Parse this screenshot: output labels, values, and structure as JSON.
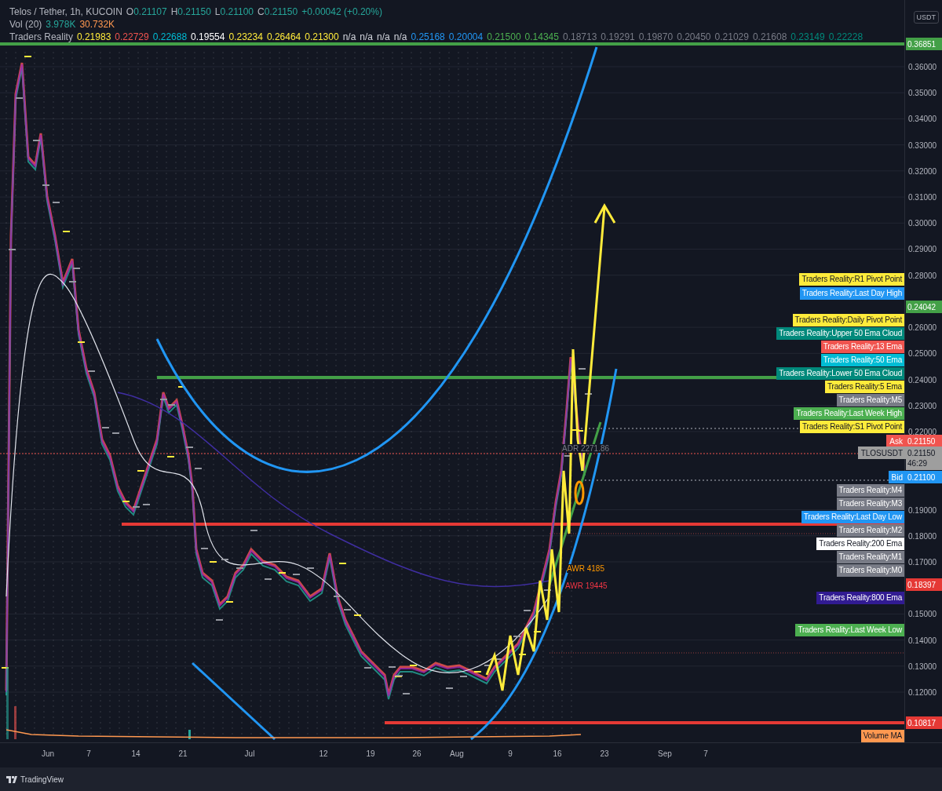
{
  "legend": {
    "symbol": "Telos / Tether, 1h, KUCOIN",
    "ohlc": [
      {
        "label": "O",
        "value": "0.21107"
      },
      {
        "label": "H",
        "value": "0.21150"
      },
      {
        "label": "L",
        "value": "0.21100"
      },
      {
        "label": "C",
        "value": "0.21150"
      }
    ],
    "change": "+0.00042 (+0.20%)",
    "volume": {
      "label": "Vol (20)",
      "values": [
        {
          "value": "3.978K",
          "color": "#26a69a"
        },
        {
          "value": "30.732K",
          "color": "#ff9850"
        }
      ]
    },
    "indicator": {
      "label": "Traders Reality",
      "values": [
        {
          "value": "0.21983",
          "color": "#ffeb3b"
        },
        {
          "value": "0.22729",
          "color": "#f0544f"
        },
        {
          "value": "0.22688",
          "color": "#00bcd4"
        },
        {
          "value": "0.19554",
          "color": "#ffffff"
        },
        {
          "value": "0.23234",
          "color": "#ffeb3b"
        },
        {
          "value": "0.26464",
          "color": "#ffeb3b"
        },
        {
          "value": "0.21300",
          "color": "#ffeb3b"
        },
        {
          "value": "n/a",
          "color": "#d1d4dc"
        },
        {
          "value": "n/a",
          "color": "#d1d4dc"
        },
        {
          "value": "n/a",
          "color": "#d1d4dc"
        },
        {
          "value": "n/a",
          "color": "#d1d4dc"
        },
        {
          "value": "0.25168",
          "color": "#2196f3"
        },
        {
          "value": "0.20004",
          "color": "#2196f3"
        },
        {
          "value": "0.21500",
          "color": "#4caf50"
        },
        {
          "value": "0.14345",
          "color": "#4caf50"
        },
        {
          "value": "0.18713",
          "color": "#787b86"
        },
        {
          "value": "0.19291",
          "color": "#787b86"
        },
        {
          "value": "0.19870",
          "color": "#787b86"
        },
        {
          "value": "0.20450",
          "color": "#787b86"
        },
        {
          "value": "0.21029",
          "color": "#787b86"
        },
        {
          "value": "0.21608",
          "color": "#787b86"
        },
        {
          "value": "0.23149",
          "color": "#00897b"
        },
        {
          "value": "0.22228",
          "color": "#00897b"
        }
      ]
    }
  },
  "price_axis": {
    "currency": "USDT",
    "ticks": [
      "0.36000",
      "0.35000",
      "0.34000",
      "0.33000",
      "0.32000",
      "0.31000",
      "0.30000",
      "0.29000",
      "0.28000",
      "0.26000",
      "0.25000",
      "0.24000",
      "0.23000",
      "0.22000",
      "0.19000",
      "0.18000",
      "0.17000",
      "0.15000",
      "0.14000",
      "0.13000",
      "0.12000"
    ],
    "price_tags": [
      {
        "value": "0.36851",
        "color": "#43a047"
      },
      {
        "value": "0.24042",
        "color": "#43a047"
      },
      {
        "label": "Ask",
        "value": "0.21150",
        "color": "#f0544f"
      },
      {
        "label": "TLOSUSDT",
        "value": "0.21150",
        "countdown": "46:29",
        "color": "#9e9e9e"
      },
      {
        "label": "Bid",
        "value": "0.21100",
        "color": "#2196f3"
      },
      {
        "value": "0.18397",
        "color": "#e53935"
      },
      {
        "value": "0.10817",
        "color": "#e53935"
      }
    ]
  },
  "indicator_labels": [
    {
      "text": "Traders Reality:R1 Pivot Point",
      "color": "#ffeb3b"
    },
    {
      "text": "Traders Reality:Last Day High",
      "color": "#2196f3"
    },
    {
      "text": "Traders Reality:Daily Pivot Point",
      "color": "#ffeb3b"
    },
    {
      "text": "Traders Reality:Upper 50 Ema Cloud",
      "color": "#00897b"
    },
    {
      "text": "Traders Reality:13 Ema",
      "color": "#f0544f"
    },
    {
      "text": "Traders Reality:50 Ema",
      "color": "#00bcd4"
    },
    {
      "text": "Traders Reality:Lower 50 Ema Cloud",
      "color": "#00897b"
    },
    {
      "text": "Traders Reality:5 Ema",
      "color": "#ffeb3b"
    },
    {
      "text": "Traders Reality:M5",
      "color": "#787b86"
    },
    {
      "text": "Traders Reality:Last Week High",
      "color": "#4caf50"
    },
    {
      "text": "Traders Reality:S1 Pivot Point",
      "color": "#ffeb3b"
    },
    {
      "text": "Traders Reality:M4",
      "color": "#787b86"
    },
    {
      "text": "Traders Reality:M3",
      "color": "#787b86"
    },
    {
      "text": "Traders Reality:Last Day Low",
      "color": "#2196f3"
    },
    {
      "text": "Traders Reality:M2",
      "color": "#787b86"
    },
    {
      "text": "Traders Reality:200 Ema",
      "color": "#ffffff"
    },
    {
      "text": "Traders Reality:M1",
      "color": "#787b86"
    },
    {
      "text": "Traders Reality:M0",
      "color": "#787b86"
    },
    {
      "text": "Traders Reality:800 Ema",
      "color": "#311b92"
    },
    {
      "text": "Traders Reality:Last Week Low",
      "color": "#4caf50"
    },
    {
      "text": "Volume MA",
      "color": "#ff9850"
    }
  ],
  "annotations": [
    {
      "text": "ADR 2271.86",
      "color": "#787b86"
    },
    {
      "text": "AWR 4185",
      "color": "#ff9800"
    },
    {
      "text": "AWR 19445",
      "color": "#f23645"
    }
  ],
  "time_axis": {
    "labels": [
      "Jun",
      "7",
      "14",
      "21",
      "Jul",
      "12",
      "19",
      "26",
      "Aug",
      "9",
      "16",
      "23",
      "Sep",
      "7"
    ]
  },
  "footer": {
    "brand": "TradingView"
  }
}
